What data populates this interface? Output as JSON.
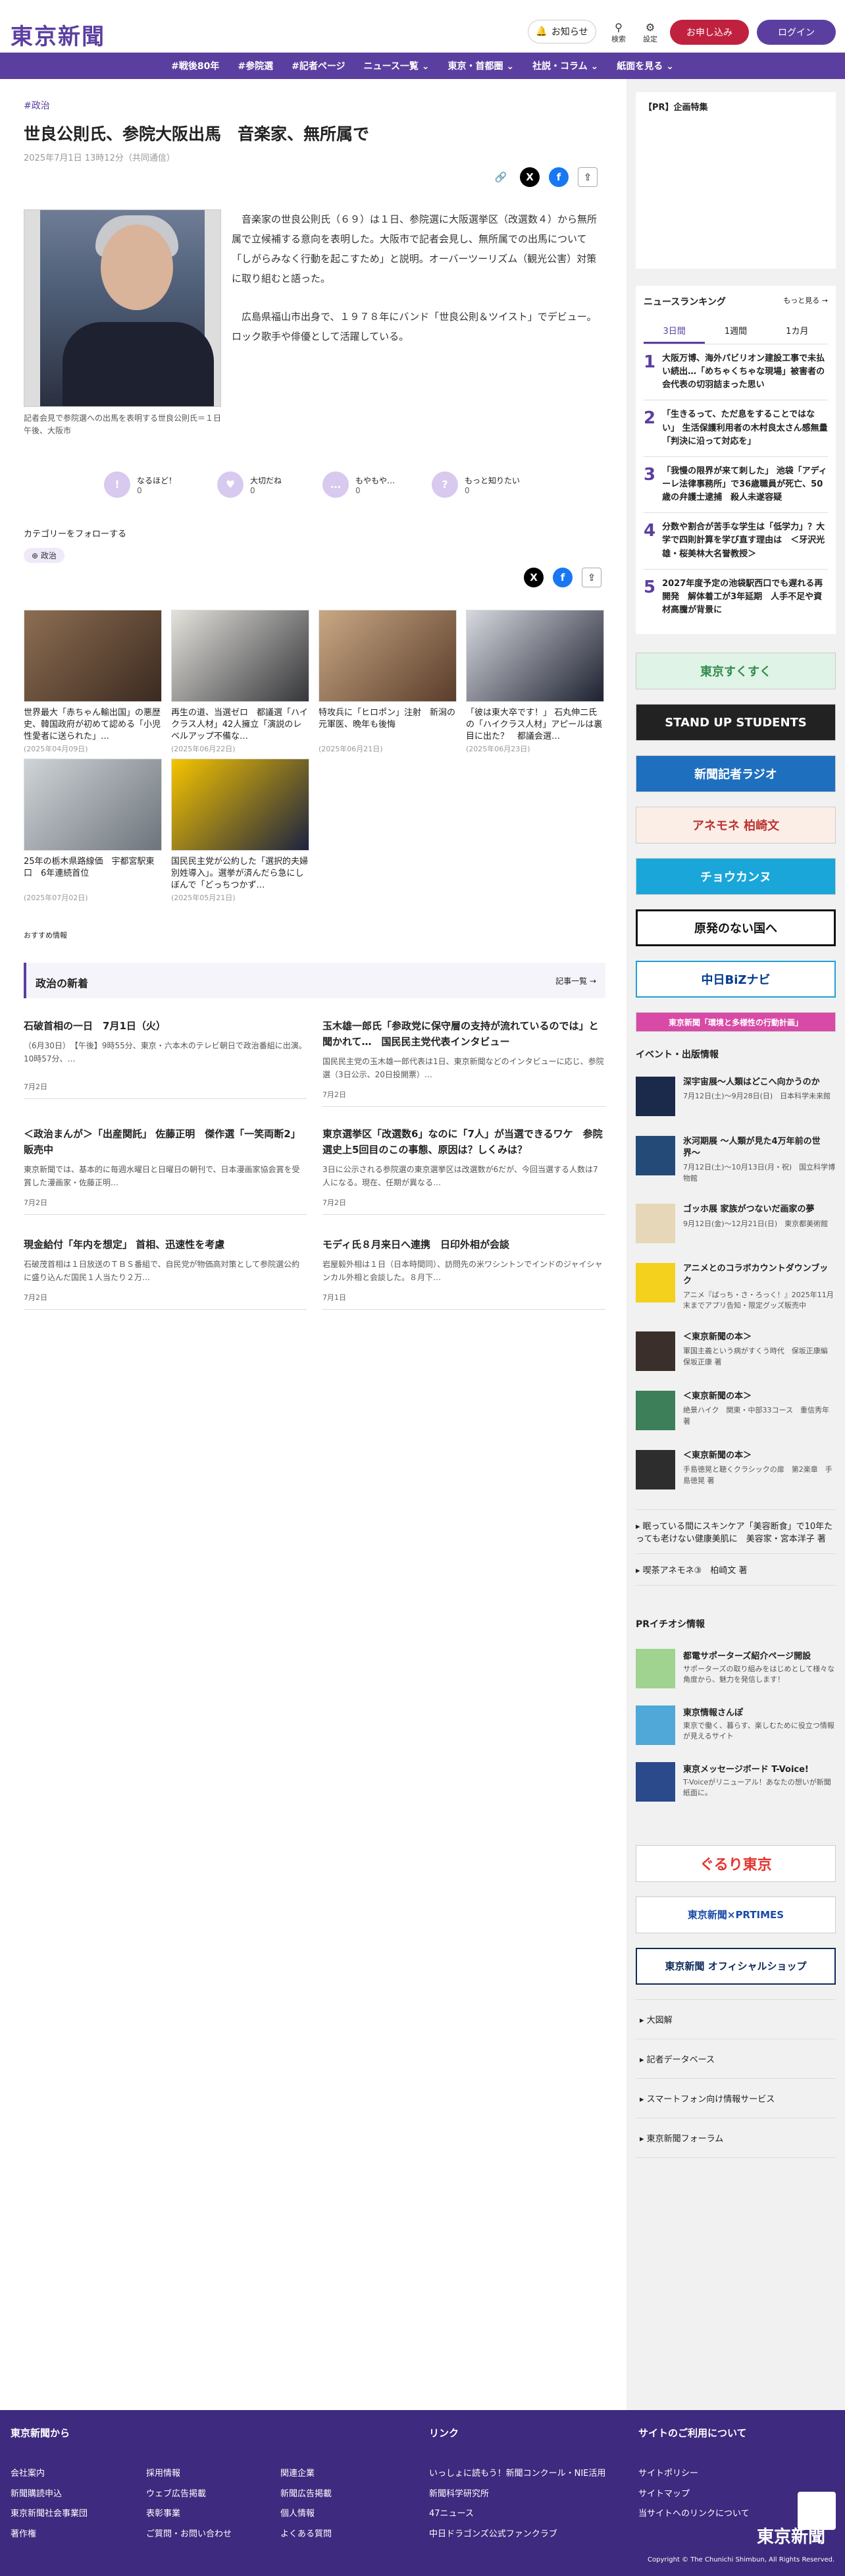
{
  "header": {
    "logo": "東京新聞",
    "notify_label": "お知らせ",
    "search_label": "検索",
    "settings_label": "設定",
    "subscribe_label": "お申し込み",
    "login_label": "ログイン"
  },
  "nav": [
    "#戦後80年",
    "#参院選",
    "#記者ページ",
    "ニュース一覧 ⌄",
    "東京・首都圏 ⌄",
    "社説・コラム ⌄",
    "紙面を見る ⌄"
  ],
  "article": {
    "tag": "#政治",
    "title": "世良公則氏、参院大阪出馬　音楽家、無所属で",
    "date": "2025年7月1日 13時12分（共同通信）",
    "body1": "音楽家の世良公則氏（６９）は１日、参院選に大阪選挙区（改選数４）から無所属で立候補する意向を表明した。大阪市で記者会見し、無所属での出馬について「しがらみなく行動を起こすため」と説明。オーバーツーリズム（観光公害）対策に取り組むと語った。",
    "body2": "広島県福山市出身で、１９７８年にバンド「世良公則＆ツイスト」でデビュー。ロック歌手や俳優として活躍している。",
    "caption": "記者会見で参院選への出馬を表明する世良公則氏＝１日午後、大阪市"
  },
  "reactions": [
    {
      "icon": "!",
      "label": "なるほど！",
      "count": "0"
    },
    {
      "icon": "♥",
      "label": "大切だね",
      "count": "0"
    },
    {
      "icon": "…",
      "label": "もやもや…",
      "count": "0"
    },
    {
      "icon": "?",
      "label": "もっと知りたい",
      "count": "0"
    }
  ],
  "follow": {
    "heading": "カテゴリーをフォローする",
    "chip": "政治"
  },
  "related": [
    {
      "title": "世界最大「赤ちゃん輸出国」の悪歴史、韓国政府が初めて認める「小児性愛者に送られた」…",
      "date": "(2025年04月09日)"
    },
    {
      "title": "再生の道、当選ゼロ　都議選「ハイクラス人材」42人擁立「演説のレベルアップ不備な…",
      "date": "(2025年06月22日)"
    },
    {
      "title": "特攻兵に「ヒロポン」注射　新潟の元軍医、晩年も後悔",
      "date": "(2025年06月21日)"
    },
    {
      "title": "「彼は東大卒です！」 石丸伸二氏の「ハイクラス人材」アピールは裏目に出た？　都議会選…",
      "date": "(2025年06月23日)"
    },
    {
      "title": "25年の栃木県路線価　宇都宮駅東口　6年連続首位",
      "date": "(2025年07月02日)"
    },
    {
      "title": "国民民主党が公約した「選択的夫婦別姓導入」。選挙が済んだら急にしぼんで「どっちつかず…",
      "date": "(2025年05月21日)"
    }
  ],
  "recommend_label": "おすすめ情報",
  "latest": {
    "heading": "政治の新着",
    "more": "記事一覧 →",
    "items": [
      {
        "title": "石破首相の一日　7月1日（火）",
        "body": "（6月30日）　【午後】9時55分、東京・六本木のテレビ朝日で政治番組に出演。10時57分、…",
        "date": "7月2日"
      },
      {
        "title": "玉木雄一郎氏「参政党に保守層の支持が流れているのでは」と聞かれて…　国民民主党代表インタビュー",
        "body": "国民民主党の玉木雄一郎代表は1日、東京新聞などのインタビューに応じ、参院選（3日公示、20日投開票）…",
        "date": "7月2日"
      },
      {
        "title": "＜政治まんが＞「出産関託」 佐藤正明　傑作選「一笑両断2」販売中",
        "body": "東京新聞では、基本的に毎週水曜日と日曜日の朝刊で、日本漫画家協会賞を受賞した漫画家・佐藤正明…",
        "date": "7月2日"
      },
      {
        "title": "東京選挙区「改選数6」なのに「7人」が当選できるワケ　参院選史上5回目のこの事態、原因は？しくみは？",
        "body": "3日に公示される参院選の東京選挙区は改選数が6だが、今回当選する人数は7人になる。現在、任期が異なる…",
        "date": "7月2日"
      },
      {
        "title": "現金給付「年内を想定」 首相、迅速性を考慮",
        "body": "石破茂首相は１日放送のＴＢＳ番組で、自民党が物価高対策として参院選公約に盛り込んだ国民１人当たり２万…",
        "date": "7月2日"
      },
      {
        "title": "モディ氏８月来日へ連携　日印外相が会談",
        "body": "岩屋毅外相は１日（日本時間同）、訪問先の米ワシントンでインドのジャイシャンカル外相と会談した。８月下…",
        "date": "7月1日"
      }
    ]
  },
  "sidebar": {
    "pr_heading": "【PR】企画特集",
    "ranking_heading": "ニュースランキング",
    "ranking_more": "もっと見る →",
    "tabs": [
      "3日間",
      "1週間",
      "1カ月"
    ],
    "ranking": [
      {
        "num": "1",
        "title": "大阪万博、海外パビリオン建設工事で未払い続出…「めちゃくちゃな現場」被害者の会代表の切羽詰まった思い"
      },
      {
        "num": "2",
        "title": "「生きるって、ただ息をすることではない」 生活保護利用者の木村良太さん感無量「判決に沿って対応を」"
      },
      {
        "num": "3",
        "title": "「我慢の限界が来て刺した」 池袋「アディーレ法律事務所」で36歳職員が死亡、50歳の弁護士逮捕　殺人未遂容疑"
      },
      {
        "num": "4",
        "title": "分数や割合が苦手な学生は「低学力」？大学で四則計算を学び直す理由は　＜牙沢光雄・桜美林大名誉教授＞"
      },
      {
        "num": "5",
        "title": "2027年度予定の池袋駅西口でも遅れる再開発　解体着工が3年延期　人手不足や資材高騰が背景に"
      }
    ],
    "banners": [
      "東京すくすく",
      "STAND UP STUDENTS",
      "新聞記者ラジオ",
      "アネモネ 柏崎文",
      "チョウカンヌ",
      "原発のない国へ",
      "中日BiZナビ",
      "東京新聞「環境と多様性の行動計画」"
    ],
    "events_heading": "イベント・出版情報",
    "events": [
      {
        "title": "深宇宙展〜人類はどこへ向かうのか",
        "sub": "7月12日(土)〜9月28日(日)　日本科学未来館"
      },
      {
        "title": "氷河期展 〜人類が見た4万年前の世界〜",
        "sub": "7月12日(土)〜10月13日(月・祝)　国立科学博物館"
      },
      {
        "title": "ゴッホ展 家族がつないだ画家の夢",
        "sub": "9月12日(金)〜12月21日(日)　東京都美術館"
      },
      {
        "title": "アニメとのコラボカウントダウンブック",
        "sub": "アニメ『ばっち・さ・ろっく！』2025年11月末までアプリ告知・限定グッズ販売中"
      },
      {
        "title": "＜東京新聞の本＞",
        "sub": "軍国主義という病がすくう時代　保坂正康編　保坂正康 著"
      },
      {
        "title": "＜東京新聞の本＞",
        "sub": "絶景ハイク　関東・中部33コース　重信秀年 著"
      },
      {
        "title": "＜東京新聞の本＞",
        "sub": "手島徳晃と聴くクラシックの扉　第2楽章　手島徳晃 著"
      }
    ],
    "links": [
      "眠っている間にスキンケア「美容断食」で10年たっても老けない健康美肌に　美容家・宮本洋子 著",
      "喫茶アネモネ③　柏崎文 著"
    ],
    "pr_info_heading": "PRイチオシ情報",
    "pr_items": [
      {
        "title": "都電サポーターズ紹介ページ開設",
        "sub": "サポーターズの取り組みをはじめとして様々な角度から、魅力を発信します！"
      },
      {
        "title": "東京情報さんぽ",
        "sub": "東京で働く、暮らす、楽しむために役立つ情報が見えるサイト"
      },
      {
        "title": "東京メッセージボード T-Voice!",
        "sub": "T-Voiceがリニューアル！あなたの想いが新聞紙面に。"
      }
    ],
    "banners2": [
      "ぐるり東京",
      "東京新聞×PRTIMES",
      "東京新聞 オフィシャルショップ"
    ],
    "bottom_links": [
      "大図解",
      "記者データベース",
      "スマートフォン向け情報サービス",
      "東京新聞フォーラム"
    ]
  },
  "footer": {
    "col1_heading": "東京新聞から",
    "col2_heading": "リンク",
    "col3_heading": "サイトのご利用について",
    "logo": "東京新聞",
    "col1a": [
      "会社案内",
      "新聞購読申込",
      "東京新聞社会事業団",
      "著作権"
    ],
    "col1b": [
      "採用情報",
      "ウェブ広告掲載",
      "表彰事業",
      "ご質問・お問い合わせ"
    ],
    "col1c": [
      "関連企業",
      "新聞広告掲載",
      "個人情報",
      "よくある質問"
    ],
    "col2": [
      "いっしょに読もう！新聞コンクール・NIE活用",
      "新聞科学研究所",
      "47ニュース",
      "中日ドラゴンズ公式ファンクラブ"
    ],
    "col3": [
      "サイトポリシー",
      "サイトマップ",
      "当サイトへのリンクについて"
    ],
    "copyright": "Copyright © The Chunichi Shimbun, All Rights Reserved."
  },
  "colors": {
    "brand": "#5b3fa0",
    "subscribe": "#c0213f",
    "footer": "#3e2a7e"
  }
}
